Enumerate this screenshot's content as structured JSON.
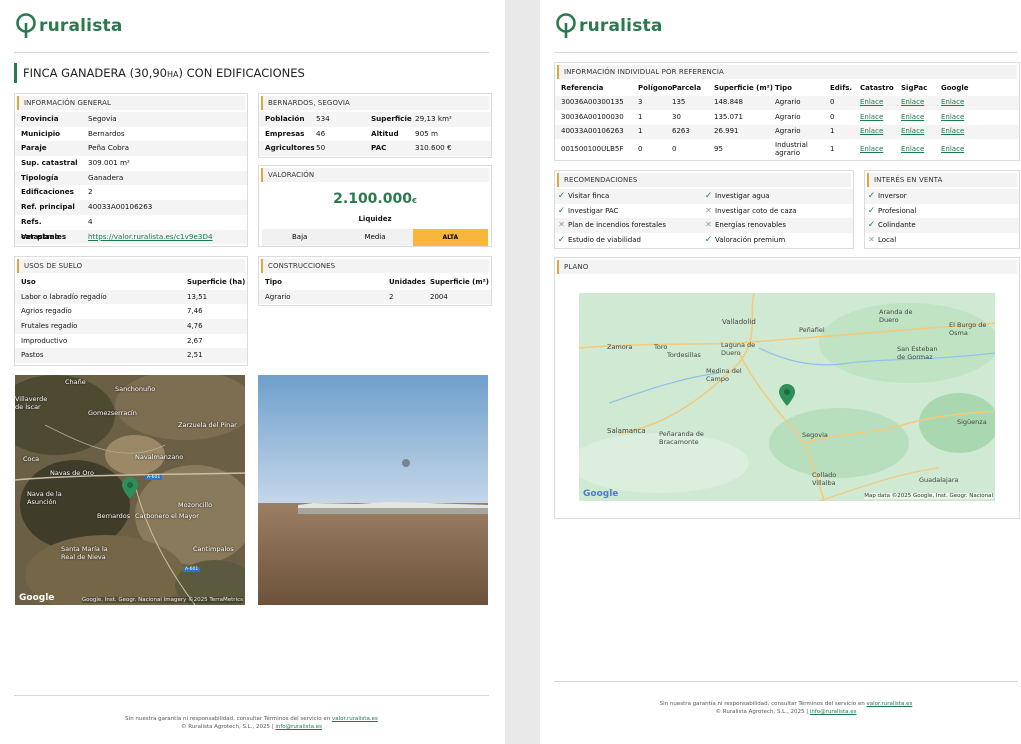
{
  "brand": "ruralista",
  "title_main": "FINCA GANADERA (30,90",
  "title_unit": "HA",
  "title_end": ") CON EDIFICACIONES",
  "general": {
    "header": "Información general",
    "rows": [
      {
        "k": "Provincia",
        "v": "Segovia"
      },
      {
        "k": "Municipio",
        "v": "Bernardos"
      },
      {
        "k": "Paraje",
        "v": "Peña Cobra"
      },
      {
        "k": "Sup. catastral",
        "v": "309.001 m²"
      },
      {
        "k": "Tipología",
        "v": "Ganadera"
      },
      {
        "k": "Edificaciones",
        "v": "2"
      },
      {
        "k": "Ref. principal",
        "v": "40033A00106263"
      },
      {
        "k": "Refs. catastrales",
        "v": "4"
      },
      {
        "k": "Ver plano",
        "v": "https://valor.ruralista.es/c1v9e3D4"
      }
    ]
  },
  "municipio": {
    "header": "Bernardos, Segovia",
    "rows": [
      {
        "k1": "Población",
        "v1": "534",
        "k2": "Superficie",
        "v2": "29,13 km²"
      },
      {
        "k1": "Empresas",
        "v1": "46",
        "k2": "Altitud",
        "v2": "905 m"
      },
      {
        "k1": "Agricultores",
        "v1": "50",
        "k2": "PAC",
        "v2": "310.600 €"
      }
    ]
  },
  "valoracion": {
    "header": "Valoración",
    "price": "2.100.000",
    "currency": "€",
    "liquidity_label": "Liquidez",
    "levels": [
      "Baja",
      "Media",
      "ALTA"
    ],
    "active_level": 2
  },
  "usos": {
    "header": "Usos de suelo",
    "col1": "Uso",
    "col2": "Superficie (ha)",
    "rows": [
      {
        "u": "Labor o labradío regadío",
        "s": "13,51"
      },
      {
        "u": "Agrios regadío",
        "s": "7,46"
      },
      {
        "u": "Frutales regadío",
        "s": "4,76"
      },
      {
        "u": "Improductivo",
        "s": "2,67"
      },
      {
        "u": "Pastos",
        "s": "2,51"
      }
    ]
  },
  "construcciones": {
    "header": "Construcciones",
    "cols": [
      "Tipo",
      "Unidades",
      "Superficie (m²)"
    ],
    "rows": [
      [
        "Agrario",
        "2",
        "2004"
      ]
    ]
  },
  "satellite": {
    "labels": [
      "Chañe",
      "Sanchonuño",
      "Villaverde de Íscar",
      "Gomezserracín",
      "Zarzuela del Pinar",
      "Coca",
      "Navalmanzano",
      "Navas de Oro",
      "Nava de la Asunción",
      "Bernardos",
      "Carbonero el Mayor",
      "Mozoncillo",
      "Santa María la Real de Nieva",
      "Cantimpalos"
    ],
    "road1": "A-601",
    "road2": "A-601",
    "attribution": "Google, Inst. Geogr. Nacional Imagery ©2025 TerraMetrics",
    "google": "Google"
  },
  "individual": {
    "header": "Información individual por referencia",
    "cols": [
      "Referencia",
      "Polígono",
      "Parcela",
      "Superficie (m²)",
      "Tipo",
      "Edifs.",
      "Catastro",
      "SigPac",
      "Google"
    ],
    "rows": [
      [
        "30036A00300135",
        "3",
        "135",
        "148.848",
        "Agrario",
        "0",
        "Enlace",
        "Enlace",
        "Enlace"
      ],
      [
        "30036A00100030",
        "1",
        "30",
        "135.071",
        "Agrario",
        "0",
        "Enlace",
        "Enlace",
        "Enlace"
      ],
      [
        "40033A00106263",
        "1",
        "6263",
        "26.991",
        "Agrario",
        "1",
        "Enlace",
        "Enlace",
        "Enlace"
      ],
      [
        "001500100ULB5F",
        "0",
        "0",
        "95",
        "Industrial agrario",
        "1",
        "Enlace",
        "Enlace",
        "Enlace"
      ]
    ]
  },
  "recomendaciones": {
    "header": "Recomendaciones",
    "items": [
      {
        "a": "Visitar finca",
        "a_ok": true,
        "b": "Investigar agua",
        "b_ok": true
      },
      {
        "a": "Investigar PAC",
        "a_ok": true,
        "b": "Investigar coto de caza",
        "b_ok": false
      },
      {
        "a": "Plan de incendios forestales",
        "a_ok": false,
        "b": "Energías renovables",
        "b_ok": false
      },
      {
        "a": "Estudio de viabilidad",
        "a_ok": true,
        "b": "Valoración premium",
        "b_ok": true
      }
    ]
  },
  "interes": {
    "header": "Interés en venta",
    "items": [
      {
        "t": "Inversor",
        "ok": true
      },
      {
        "t": "Profesional",
        "ok": true
      },
      {
        "t": "Colindante",
        "ok": true
      },
      {
        "t": "Local",
        "ok": false
      }
    ]
  },
  "plano": {
    "header": "Plano",
    "labels": [
      "Aranda de Duero",
      "Valladolid",
      "Peñafiel",
      "El Burgo de Osma",
      "Zamora",
      "Toro",
      "Tordesillas",
      "Laguna de Duero",
      "San Esteban de Gormaz",
      "Medina del Campo",
      "Sigüenza",
      "Salamanca",
      "Peñaranda de Bracamonte",
      "Segovia",
      "Collado Villalba",
      "Guadalajara"
    ],
    "attribution": "Map data ©2025 Google, Inst. Geogr. Nacional",
    "google": "Google"
  },
  "footer": {
    "line1": "Sin nuestra garantía ni responsabilidad, consultar Términos del servicio en ",
    "link1": "valor.ruralista.es",
    "line2": "© Ruralista Agrotech, S.L., 2025 | ",
    "link2": "info@ruralista.es"
  }
}
